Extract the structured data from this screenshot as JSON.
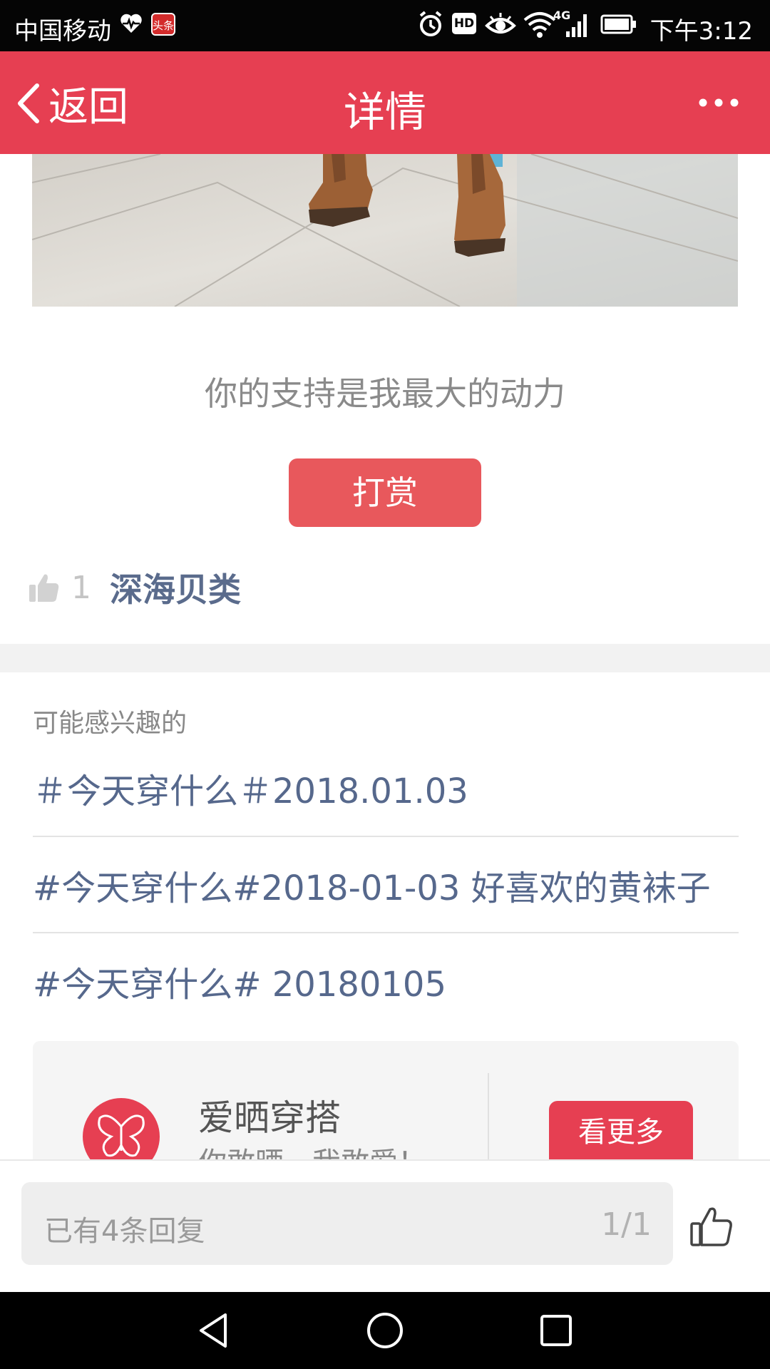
{
  "status_bar": {
    "carrier": "中国移动",
    "toutiao_badge": "头条",
    "time": "下午3:12",
    "network": "4G",
    "hd_label": "HD",
    "icons": [
      "heart-pulse-icon",
      "toutiao-app-icon",
      "alarm-icon",
      "hd-icon",
      "eye-icon",
      "wifi-icon",
      "signal-icon",
      "battery-icon"
    ]
  },
  "header": {
    "back_label": "返回",
    "title": "详情",
    "more_icon": "more-dots-icon",
    "color": "#e63f52"
  },
  "post": {
    "image_icon": "photo-boots-on-tiles"
  },
  "reward": {
    "support_text": "你的支持是我最大的动力",
    "button_label": "打赏",
    "button_color": "#e8585c"
  },
  "likes": {
    "count": "1",
    "names": "深海贝类"
  },
  "related": {
    "heading": "可能感兴趣的",
    "items": [
      {
        "label": "＃今天穿什么＃2018.01.03"
      },
      {
        "label": "#今天穿什么#2018-01-03 好喜欢的黄袜子"
      },
      {
        "label": "#今天穿什么# 20180105"
      }
    ]
  },
  "promo": {
    "name": "爱晒穿搭",
    "slogan": "你敢晒，我敢爱！",
    "more_label": "看更多",
    "logo_icon": "butterfly-icon"
  },
  "reply_bar": {
    "placeholder": "已有4条回复",
    "page": "1/1",
    "like_icon": "thumbs-up-outline-icon"
  },
  "nav_bar": {
    "icons": [
      "back-triangle-icon",
      "home-circle-icon",
      "recents-square-icon"
    ]
  }
}
